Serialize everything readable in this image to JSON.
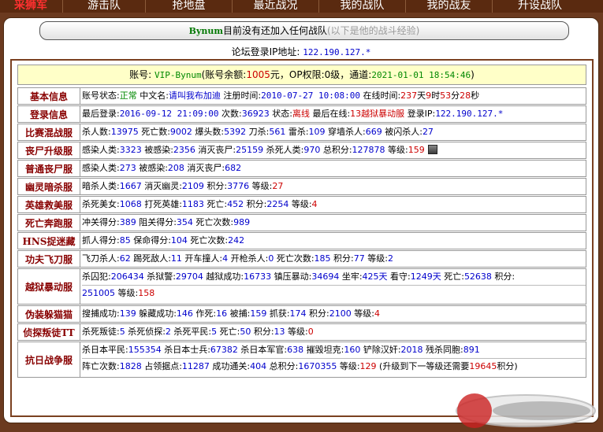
{
  "nav": {
    "logo": "采狮军",
    "items": [
      "游击队",
      "抢地盘",
      "最近战况",
      "我的战队",
      "我的战友",
      "升设战队"
    ]
  },
  "banner": {
    "name": "Bynum",
    "text": "目前没有还加入任何战队",
    "note": "(以下是他的战斗经验)"
  },
  "forum_ip": {
    "label": "论坛登录IP地址:",
    "value": "122.190.127.*"
  },
  "account": {
    "label1": "账号:",
    "account": "VIP-Bynum",
    "label2": "(账号余额:",
    "balance": "1005",
    "label3": "元，OP权限:",
    "op": "0级",
    "label4": "，通道:",
    "date": "2021-01-01 18:54:46",
    "label5": ")"
  },
  "rows": [
    {
      "label": "基本信息",
      "lines": [
        [
          {
            "t": "账号状态:"
          },
          {
            "t": "正常",
            "c": "green"
          },
          {
            "t": " 中文名:"
          },
          {
            "t": "请叫我布加迪",
            "c": "blue"
          },
          {
            "t": " 注册时间:"
          },
          {
            "t": "2010-07-27 10:08:00",
            "c": "blue mono"
          },
          {
            "t": " 在线时间:"
          },
          {
            "t": "237",
            "c": "red"
          },
          {
            "t": "天"
          },
          {
            "t": "9",
            "c": "red"
          },
          {
            "t": "时"
          },
          {
            "t": "53",
            "c": "red"
          },
          {
            "t": "分"
          },
          {
            "t": "28",
            "c": "red"
          },
          {
            "t": "秒"
          }
        ]
      ]
    },
    {
      "label": "登录信息",
      "lines": [
        [
          {
            "t": "最后登录:"
          },
          {
            "t": "2016-09-12 21:09:00",
            "c": "blue mono"
          },
          {
            "t": " 次数:"
          },
          {
            "t": "36923",
            "c": "blue"
          },
          {
            "t": " 状态:"
          },
          {
            "t": "离线",
            "c": "red"
          },
          {
            "t": " 最后在线:"
          },
          {
            "t": "13越狱暴动服",
            "c": "red"
          },
          {
            "t": " 登录IP:"
          },
          {
            "t": "122.190.127.*",
            "c": "blue mono"
          }
        ]
      ]
    },
    {
      "label": "比赛混战服",
      "lines": [
        [
          {
            "t": "杀人数:"
          },
          {
            "t": "13975",
            "c": "blue"
          },
          {
            "t": " 死亡数:"
          },
          {
            "t": "9002",
            "c": "blue"
          },
          {
            "t": " 爆头数:"
          },
          {
            "t": "5392",
            "c": "blue"
          },
          {
            "t": " 刀杀:"
          },
          {
            "t": "561",
            "c": "blue"
          },
          {
            "t": " 雷杀:"
          },
          {
            "t": "109",
            "c": "blue"
          },
          {
            "t": " 穿墙杀人:"
          },
          {
            "t": "669",
            "c": "blue"
          },
          {
            "t": " 被闪杀人:"
          },
          {
            "t": "27",
            "c": "blue"
          }
        ]
      ]
    },
    {
      "label": "丧尸升级服",
      "icon": true,
      "lines": [
        [
          {
            "t": "感染人类:"
          },
          {
            "t": "3323",
            "c": "blue"
          },
          {
            "t": " 被感染:"
          },
          {
            "t": "2356",
            "c": "blue"
          },
          {
            "t": " 消灭丧尸:"
          },
          {
            "t": "25159",
            "c": "blue"
          },
          {
            "t": " 杀死人类:"
          },
          {
            "t": "970",
            "c": "blue"
          },
          {
            "t": " 总积分:"
          },
          {
            "t": "127878",
            "c": "blue"
          },
          {
            "t": " 等级:"
          },
          {
            "t": "159",
            "c": "red"
          }
        ]
      ]
    },
    {
      "label": "普通丧尸服",
      "lines": [
        [
          {
            "t": "感染人类:"
          },
          {
            "t": "273",
            "c": "blue"
          },
          {
            "t": " 被感染:"
          },
          {
            "t": "208",
            "c": "blue"
          },
          {
            "t": " 消灭丧尸:"
          },
          {
            "t": "682",
            "c": "blue"
          }
        ]
      ]
    },
    {
      "label": "幽灵暗杀服",
      "lines": [
        [
          {
            "t": "暗杀人类:"
          },
          {
            "t": "1667",
            "c": "blue"
          },
          {
            "t": " 消灭幽灵:"
          },
          {
            "t": "2109",
            "c": "blue"
          },
          {
            "t": " 积分:"
          },
          {
            "t": "3776",
            "c": "blue"
          },
          {
            "t": " 等级:"
          },
          {
            "t": "27",
            "c": "red"
          }
        ]
      ]
    },
    {
      "label": "英雄救美服",
      "lines": [
        [
          {
            "t": "杀死美女:"
          },
          {
            "t": "1068",
            "c": "blue"
          },
          {
            "t": " 打死英雄:"
          },
          {
            "t": "1183",
            "c": "blue"
          },
          {
            "t": " 死亡:"
          },
          {
            "t": "452",
            "c": "blue"
          },
          {
            "t": " 积分:"
          },
          {
            "t": "2254",
            "c": "blue"
          },
          {
            "t": " 等级:"
          },
          {
            "t": "4",
            "c": "red"
          }
        ]
      ]
    },
    {
      "label": "死亡奔跑服",
      "lines": [
        [
          {
            "t": "冲关得分:"
          },
          {
            "t": "389",
            "c": "blue"
          },
          {
            "t": " 阻关得分:"
          },
          {
            "t": "354",
            "c": "blue"
          },
          {
            "t": " 死亡次数:"
          },
          {
            "t": "989",
            "c": "blue"
          }
        ]
      ]
    },
    {
      "label": "HNS捉迷藏",
      "lines": [
        [
          {
            "t": "抓人得分:"
          },
          {
            "t": "85",
            "c": "blue"
          },
          {
            "t": " 保命得分:"
          },
          {
            "t": "104",
            "c": "blue"
          },
          {
            "t": " 死亡次数:"
          },
          {
            "t": "242",
            "c": "blue"
          }
        ]
      ]
    },
    {
      "label": "功夫飞刀服",
      "lines": [
        [
          {
            "t": "飞刀杀人:"
          },
          {
            "t": "62",
            "c": "blue"
          },
          {
            "t": " 踢死敌人:"
          },
          {
            "t": "11",
            "c": "blue"
          },
          {
            "t": " 开车撞人:"
          },
          {
            "t": "4",
            "c": "blue"
          },
          {
            "t": " 开枪杀人:"
          },
          {
            "t": "0",
            "c": "blue"
          },
          {
            "t": " 死亡次数:"
          },
          {
            "t": "185",
            "c": "blue"
          },
          {
            "t": " 积分:"
          },
          {
            "t": "77",
            "c": "blue"
          },
          {
            "t": " 等级:"
          },
          {
            "t": "2",
            "c": "blue"
          }
        ]
      ]
    },
    {
      "label": "越狱暴动服",
      "lines": [
        [
          {
            "t": "杀囚犯:"
          },
          {
            "t": "206434",
            "c": "blue"
          },
          {
            "t": " 杀狱警:"
          },
          {
            "t": "29704",
            "c": "blue"
          },
          {
            "t": " 越狱成功:"
          },
          {
            "t": "16733",
            "c": "blue"
          },
          {
            "t": " 镇压暴动:"
          },
          {
            "t": "34694",
            "c": "blue"
          },
          {
            "t": " 坐牢:"
          },
          {
            "t": "425天",
            "c": "blue"
          },
          {
            "t": " 看守:"
          },
          {
            "t": "1249天",
            "c": "blue"
          },
          {
            "t": " 死亡:"
          },
          {
            "t": "52638",
            "c": "blue"
          },
          {
            "t": " 积分:"
          }
        ],
        [
          {
            "t": "251005",
            "c": "blue"
          },
          {
            "t": " 等级:"
          },
          {
            "t": "158",
            "c": "red"
          }
        ]
      ]
    },
    {
      "label": "伪装躲猫猫",
      "lines": [
        [
          {
            "t": "搜捕成功:"
          },
          {
            "t": "139",
            "c": "blue"
          },
          {
            "t": " 躲藏成功:"
          },
          {
            "t": "146",
            "c": "blue"
          },
          {
            "t": " 作死:"
          },
          {
            "t": "16",
            "c": "blue"
          },
          {
            "t": " 被捕:"
          },
          {
            "t": "159",
            "c": "blue"
          },
          {
            "t": " 抓获:"
          },
          {
            "t": "174",
            "c": "blue"
          },
          {
            "t": " 积分:"
          },
          {
            "t": "2100",
            "c": "blue"
          },
          {
            "t": " 等级:"
          },
          {
            "t": "4",
            "c": "red"
          }
        ]
      ]
    },
    {
      "label": "侦探叛徒TT",
      "lines": [
        [
          {
            "t": "杀死叛徒:"
          },
          {
            "t": "5",
            "c": "blue"
          },
          {
            "t": " 杀死侦探:"
          },
          {
            "t": "2",
            "c": "blue"
          },
          {
            "t": " 杀死平民:"
          },
          {
            "t": "5",
            "c": "blue"
          },
          {
            "t": " 死亡:"
          },
          {
            "t": "50",
            "c": "blue"
          },
          {
            "t": " 积分:"
          },
          {
            "t": "13",
            "c": "blue"
          },
          {
            "t": " 等级:"
          },
          {
            "t": "0",
            "c": "red"
          }
        ]
      ]
    },
    {
      "label": "抗日战争服",
      "lines": [
        [
          {
            "t": "杀日本平民:"
          },
          {
            "t": "155354",
            "c": "blue"
          },
          {
            "t": " 杀日本士兵:"
          },
          {
            "t": "67382",
            "c": "blue"
          },
          {
            "t": " 杀日本军官:"
          },
          {
            "t": "638",
            "c": "blue"
          },
          {
            "t": " 摧毁坦克:"
          },
          {
            "t": "160",
            "c": "blue"
          },
          {
            "t": " 铲除汉奸:"
          },
          {
            "t": "2018",
            "c": "blue"
          },
          {
            "t": " 残杀同胞:"
          },
          {
            "t": "891",
            "c": "blue"
          }
        ],
        [
          {
            "t": "阵亡次数:"
          },
          {
            "t": "1828",
            "c": "blue"
          },
          {
            "t": " 占领据点:"
          },
          {
            "t": "11287",
            "c": "blue"
          },
          {
            "t": " 成功通关:"
          },
          {
            "t": "404",
            "c": "blue"
          },
          {
            "t": " 总积分:"
          },
          {
            "t": "1670355",
            "c": "blue"
          },
          {
            "t": " 等级:"
          },
          {
            "t": "129",
            "c": "red"
          },
          {
            "t": " (升级到下一等级还需要"
          },
          {
            "t": "19645",
            "c": "red"
          },
          {
            "t": "积分)"
          }
        ]
      ]
    }
  ]
}
